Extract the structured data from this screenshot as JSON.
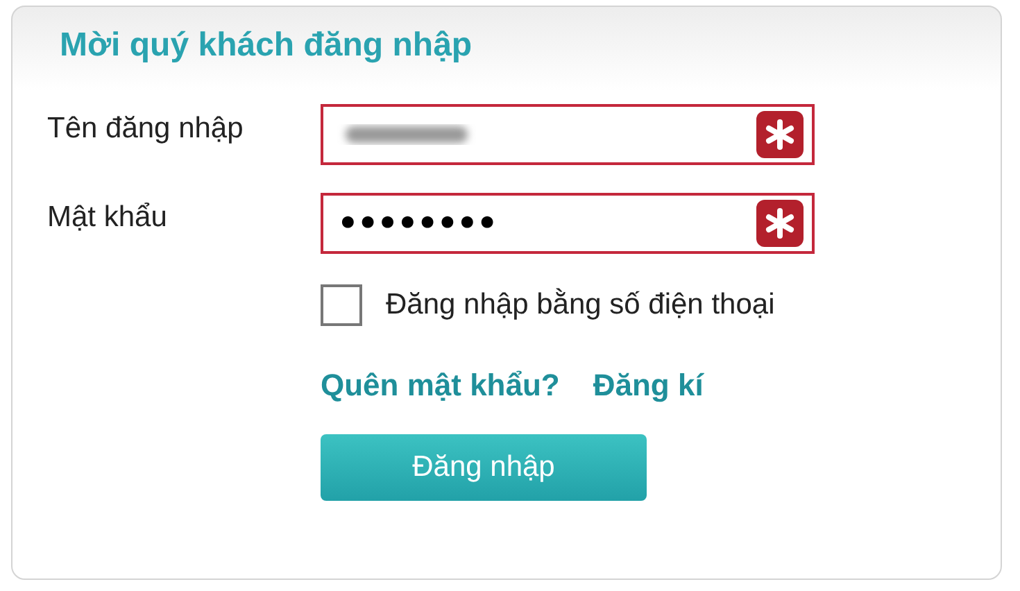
{
  "title": "Mời quý khách đăng nhập",
  "fields": [
    {
      "label": "Tên đăng nhập",
      "value_obscured": true,
      "required": true
    },
    {
      "label": "Mật khẩu",
      "value": "••••••••",
      "required": true
    }
  ],
  "phone_login": {
    "label": "Đăng nhập bằng số điện thoại",
    "checked": false
  },
  "links": [
    "Quên mật khẩu?",
    "Đăng kí"
  ],
  "submit": "Đăng nhập"
}
